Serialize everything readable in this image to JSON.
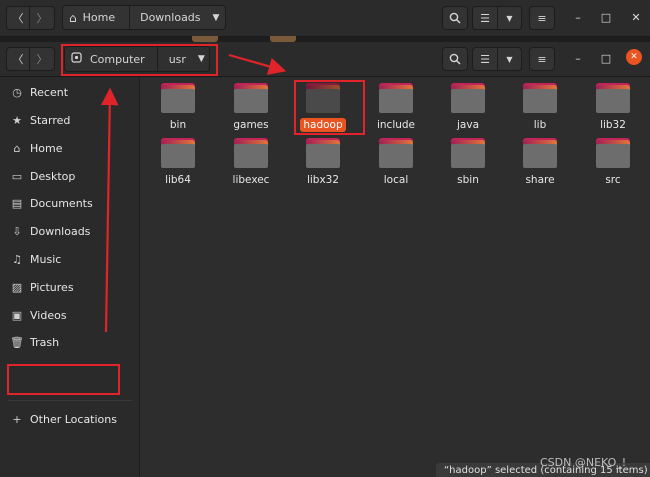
{
  "back_window": {
    "nav_back_icon": "chevron-left-icon",
    "nav_forward_icon": "chevron-right-icon",
    "path": [
      {
        "icon": "home-icon",
        "label": "Home"
      },
      {
        "label": "Downloads"
      }
    ],
    "path_dropdown_icon": "chevron-down-icon"
  },
  "front_window": {
    "path": [
      {
        "icon": "drive-icon",
        "label": "Computer"
      },
      {
        "label": "usr"
      }
    ],
    "path_dropdown_icon": "chevron-down-icon",
    "sidebar": {
      "items": [
        {
          "icon": "recent-icon",
          "glyph": "◷",
          "label": "Recent"
        },
        {
          "icon": "star-icon",
          "glyph": "★",
          "label": "Starred"
        },
        {
          "icon": "home-icon",
          "glyph": "⌂",
          "label": "Home"
        },
        {
          "icon": "desktop-icon",
          "glyph": "▭",
          "label": "Desktop"
        },
        {
          "icon": "documents-icon",
          "glyph": "▤",
          "label": "Documents"
        },
        {
          "icon": "downloads-icon",
          "glyph": "⇩",
          "label": "Downloads"
        },
        {
          "icon": "music-icon",
          "glyph": "♫",
          "label": "Music"
        },
        {
          "icon": "pictures-icon",
          "glyph": "▨",
          "label": "Pictures"
        },
        {
          "icon": "videos-icon",
          "glyph": "▣",
          "label": "Videos"
        },
        {
          "icon": "trash-icon",
          "glyph": "🗑",
          "label": "Trash"
        }
      ],
      "other_locations": {
        "icon": "plus-icon",
        "glyph": "+",
        "label": "Other Locations"
      }
    },
    "folders": [
      {
        "label": "bin",
        "selected": false
      },
      {
        "label": "games",
        "selected": false
      },
      {
        "label": "hadoop",
        "selected": true
      },
      {
        "label": "include",
        "selected": false
      },
      {
        "label": "java",
        "selected": false
      },
      {
        "label": "lib",
        "selected": false
      },
      {
        "label": "lib32",
        "selected": false
      },
      {
        "label": "lib64",
        "selected": false
      },
      {
        "label": "libexec",
        "selected": false
      },
      {
        "label": "libx32",
        "selected": false
      },
      {
        "label": "local",
        "selected": false
      },
      {
        "label": "sbin",
        "selected": false
      },
      {
        "label": "share",
        "selected": false
      },
      {
        "label": "src",
        "selected": false
      }
    ],
    "status_text": "“hadoop” selected  (containing 15 items)",
    "close_color": "#e95420",
    "selection_color": "#e95420"
  },
  "watermark": "CSDN @NEKO_!",
  "annotation_color": "#e0242a"
}
